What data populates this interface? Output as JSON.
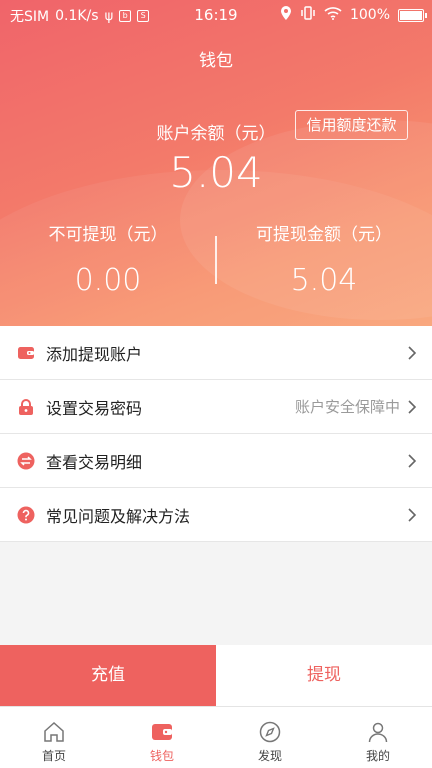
{
  "status_bar": {
    "carrier": "无SIM",
    "speed": "0.1K/s",
    "time": "16:19",
    "battery": "100%"
  },
  "header": {
    "title": "钱包",
    "balance_label": "账户余额（元）",
    "balance_value": "5.04",
    "credit_button": "信用额度还款",
    "non_withdrawable_label": "不可提现（元）",
    "non_withdrawable_value": "0.00",
    "withdrawable_label": "可提现金额（元）",
    "withdrawable_value": "5.04"
  },
  "menu": {
    "items": [
      {
        "icon": "wallet-icon",
        "label": "添加提现账户",
        "extra": ""
      },
      {
        "icon": "lock-icon",
        "label": "设置交易密码",
        "extra": "账户安全保障中"
      },
      {
        "icon": "exchange-icon",
        "label": "查看交易明细",
        "extra": ""
      },
      {
        "icon": "question-icon",
        "label": "常见问题及解决方法",
        "extra": ""
      }
    ]
  },
  "actions": {
    "recharge": "充值",
    "withdraw": "提现"
  },
  "tabbar": {
    "items": [
      {
        "icon": "home-icon",
        "label": "首页"
      },
      {
        "icon": "wallet-icon",
        "label": "钱包"
      },
      {
        "icon": "compass-icon",
        "label": "发现"
      },
      {
        "icon": "user-icon",
        "label": "我的"
      }
    ],
    "active_index": 1
  },
  "colors": {
    "accent": "#ee625f",
    "gradient_start": "#f0646a",
    "gradient_end": "#f9a377"
  }
}
